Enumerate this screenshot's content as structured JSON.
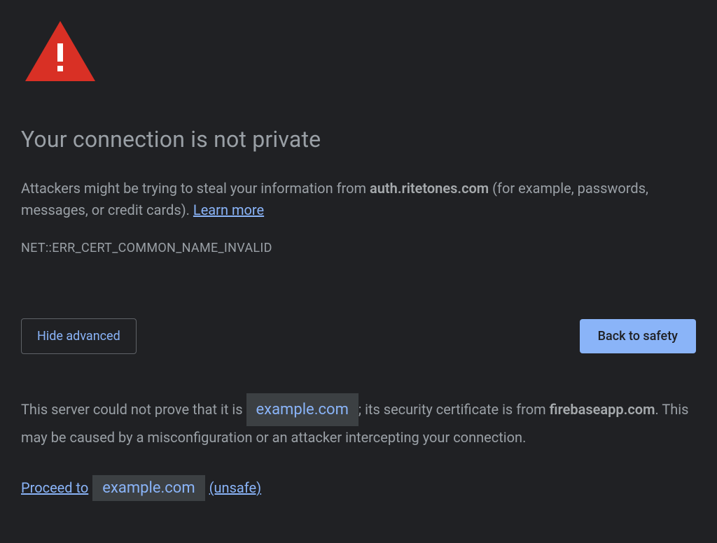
{
  "title": "Your connection is not private",
  "description": {
    "prefix": "Attackers might be trying to steal your information from ",
    "domain": "auth.ritetones.com",
    "suffix": " (for example, passwords, messages, or credit cards). ",
    "learn_more": "Learn more"
  },
  "error_code": "NET::ERR_CERT_COMMON_NAME_INVALID",
  "buttons": {
    "advanced": "Hide advanced",
    "safety": "Back to safety"
  },
  "details": {
    "part1": "This server could not prove that it is ",
    "redacted1": "example.com",
    "part2": "; its security certificate is from ",
    "cert_domain": "firebaseapp.com",
    "part3": ". This may be caused by a misconfiguration or an attacker intercepting your connection."
  },
  "proceed": {
    "prefix": "Proceed to",
    "redacted": "example.com",
    "suffix": "(unsafe)"
  }
}
